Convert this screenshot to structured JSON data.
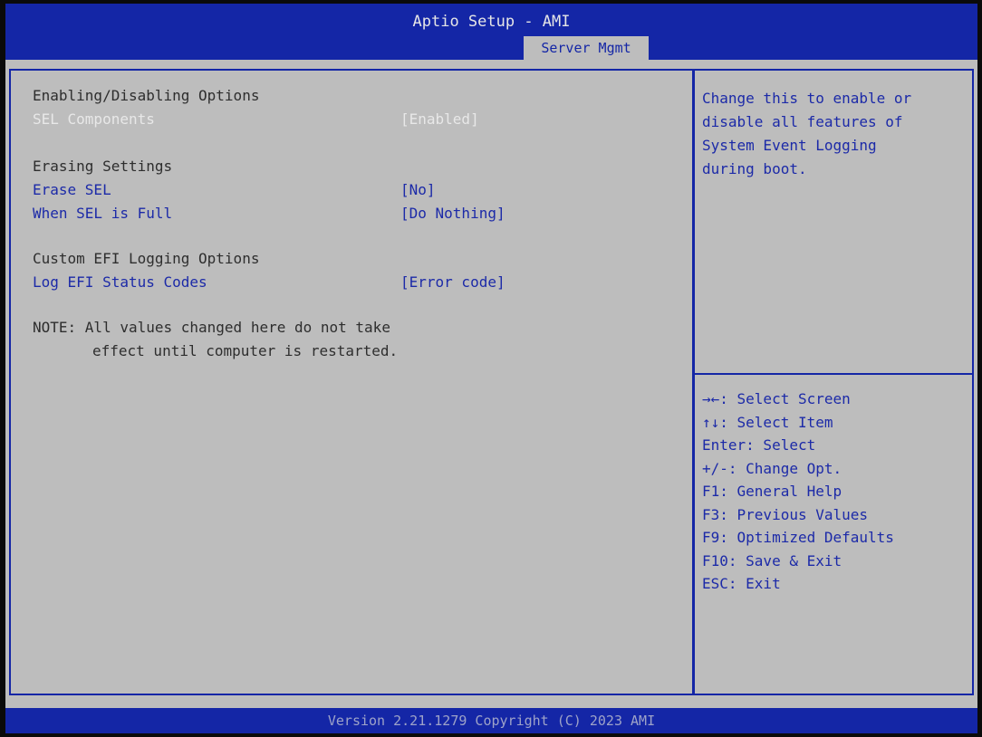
{
  "header": {
    "title": "Aptio Setup - AMI",
    "active_tab": "Server Mgmt"
  },
  "main": {
    "sections": [
      {
        "heading": "Enabling/Disabling Options",
        "items": [
          {
            "label": "SEL Components",
            "value": "[Enabled]",
            "selected": true
          }
        ]
      },
      {
        "heading": "Erasing Settings",
        "items": [
          {
            "label": "Erase SEL",
            "value": "[No]",
            "selected": false
          },
          {
            "label": "When SEL is Full",
            "value": "[Do Nothing]",
            "selected": false
          }
        ]
      },
      {
        "heading": "Custom EFI Logging Options",
        "items": [
          {
            "label": "Log EFI Status Codes",
            "value": "[Error code]",
            "selected": false
          }
        ]
      }
    ],
    "note_line1": "NOTE: All values changed here do not take",
    "note_line2": "effect until computer is restarted."
  },
  "help": {
    "description": "Change this to enable or\ndisable all features of\nSystem Event Logging\nduring boot.",
    "keys": [
      "→←: Select Screen",
      "↑↓: Select Item",
      "Enter: Select",
      "+/-: Change Opt.",
      "F1: General Help",
      "F3: Previous Values",
      "F9: Optimized Defaults",
      "F10: Save & Exit",
      "ESC: Exit"
    ]
  },
  "footer": {
    "text": "Version 2.21.1279 Copyright (C) 2023 AMI"
  },
  "colors": {
    "bar_blue": "#1426a6",
    "background_gray": "#bdbdbd",
    "link_blue": "#1c2aa8",
    "selected_white": "#e8e8e8"
  }
}
